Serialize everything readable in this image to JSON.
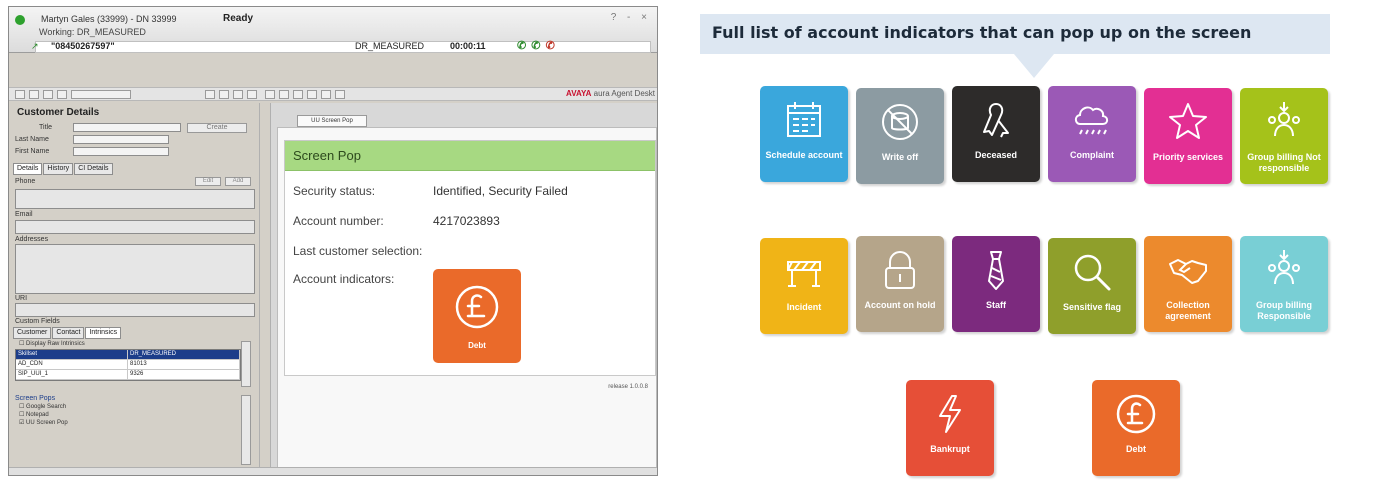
{
  "agent_app": {
    "agent": "Martyn Gales (33999) - DN 33999",
    "state": "Ready",
    "window_controls": "? - ×",
    "working": "Working: DR_MEASURED",
    "call_number": "\"08450267597\"",
    "call_state": "DR_MEASURED",
    "call_timer": "00:00:11",
    "call_actions": "✆ ✆ ✆",
    "brand_prefix": "AVAYA",
    "brand_suffix": "aura Agent Deskt",
    "customer_details": {
      "title": "Customer Details",
      "field_labels": [
        "Title",
        "Last Name",
        "First Name"
      ],
      "create_label": "Create",
      "tabs": [
        "Details",
        "History",
        "CI Details"
      ],
      "phone_label": "Phone",
      "edit_label": "Edit",
      "add_label": "Add",
      "email_label": "Email",
      "addresses_label": "Addresses",
      "uri_label": "URI",
      "custom_fields_label": "Custom Fields",
      "sub_tabs": [
        "Customer",
        "Contact",
        "Intrinsics"
      ],
      "display_raw": "Display Raw Intrinsics",
      "intrinsics_rows": [
        {
          "key": "Skillset",
          "value": "DR_MEASURED"
        },
        {
          "key": "AD_CDN",
          "value": "81013"
        },
        {
          "key": "SIP_UUI_1",
          "value": "9326"
        }
      ],
      "screen_pops_label": "Screen Pops",
      "screen_pops": [
        "Google Search",
        "Notepad",
        "UU Screen Pop"
      ]
    },
    "doc_tab": "UU Screen Pop",
    "screen_pop": {
      "header": "Screen Pop",
      "rows": [
        {
          "label": "Security status:",
          "value": "Identified, Security Failed"
        },
        {
          "label": "Account number:",
          "value": "4217023893"
        },
        {
          "label": "Last customer selection:",
          "value": ""
        },
        {
          "label": "Account indicators:",
          "value": ""
        }
      ],
      "indicator": {
        "label": "Debt",
        "icon": "pound-icon",
        "color": "#ea6a2a"
      },
      "release": "release 1.0.0.8"
    }
  },
  "legend": {
    "title": "Full list of account indicators that can pop up on the screen",
    "rows": [
      [
        {
          "label": "Schedule account",
          "icon": "calendar-icon",
          "color": "#3aa7dc"
        },
        {
          "label": "Write off",
          "icon": "coins-crossed-icon",
          "color": "#8c9ba2"
        },
        {
          "label": "Deceased",
          "icon": "ribbon-icon",
          "color": "#2d2b2a"
        },
        {
          "label": "Complaint",
          "icon": "storm-cloud-icon",
          "color": "#9b59b6"
        },
        {
          "label": "Priority services",
          "icon": "star-icon",
          "color": "#e32f93"
        },
        {
          "label": "Group billing Not responsible",
          "icon": "group-icon",
          "color": "#a5c21a"
        }
      ],
      [
        {
          "label": "Incident",
          "icon": "barrier-icon",
          "color": "#f0b417"
        },
        {
          "label": "Account on hold",
          "icon": "padlock-icon",
          "color": "#b5a58a"
        },
        {
          "label": "Staff",
          "icon": "tie-icon",
          "color": "#7c2a7e"
        },
        {
          "label": "Sensitive flag",
          "icon": "magnifier-icon",
          "color": "#8f9f2b"
        },
        {
          "label": "Collection agreement",
          "icon": "handshake-icon",
          "color": "#ec8a2d"
        },
        {
          "label": "Group billing Responsible",
          "icon": "group-icon",
          "color": "#79cfd5"
        }
      ],
      [
        {
          "label": "Bankrupt",
          "icon": "lightning-icon",
          "color": "#e64f37"
        },
        {
          "label": "Debt",
          "icon": "pound-icon",
          "color": "#ea6a2a"
        }
      ]
    ]
  }
}
